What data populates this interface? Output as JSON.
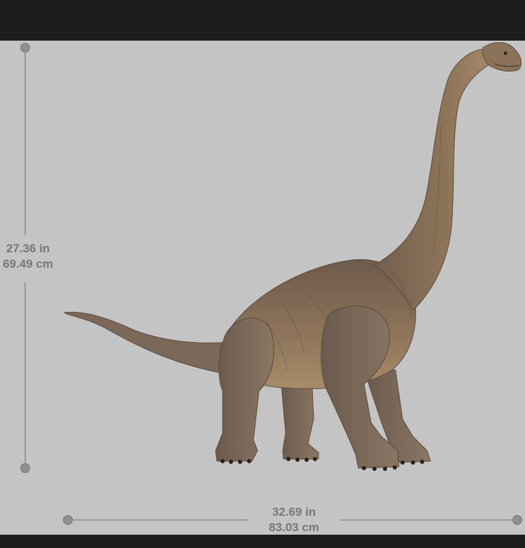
{
  "image": {
    "subject": "brachiosaurus-toy-figure",
    "background_color": "#c4c4c4",
    "frame_color": "#1c1c1c",
    "dimension_color": "#777777"
  },
  "height_dimension": {
    "imperial": "27.36 in",
    "metric": "69.49 cm"
  },
  "width_dimension": {
    "imperial": "32.69 in",
    "metric": "83.03 cm"
  }
}
